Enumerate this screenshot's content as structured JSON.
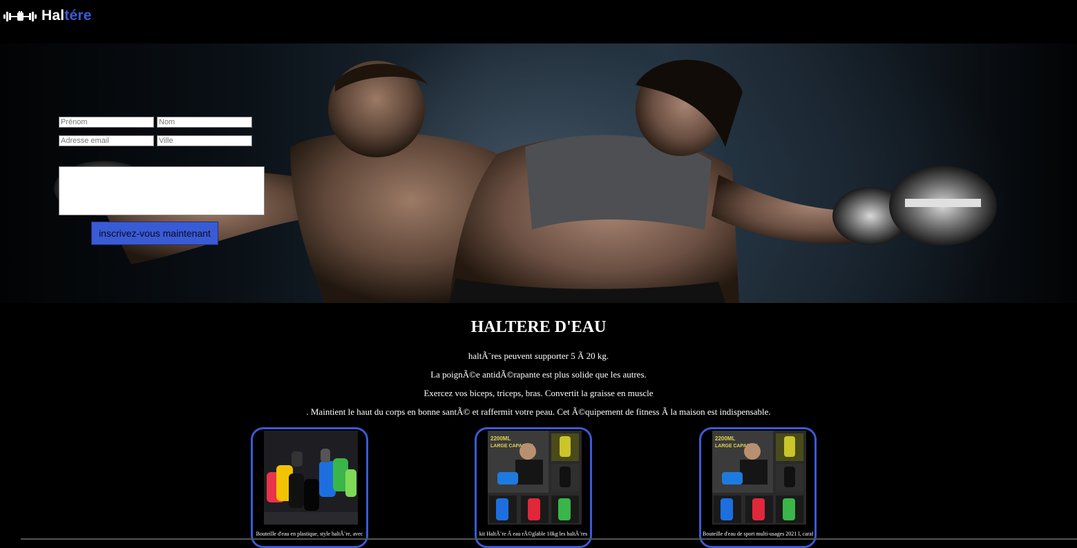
{
  "brand": {
    "name_part1": "Hal",
    "name_part2": "tére",
    "accent_color": "#3a5bd6",
    "icon": "dumbbell-fist-icon"
  },
  "form": {
    "first_name_placeholder": "Prénom",
    "last_name_placeholder": "Nom",
    "email_placeholder": "Adresse email",
    "city_placeholder": "Ville",
    "message_placeholder": "",
    "submit_label": "inscrivez-vous maintenant"
  },
  "content": {
    "title": "HALTERE D'EAU",
    "lines": [
      "haltÃ¨res peuvent supporter 5 Ã  20 kg.",
      "La poignÃ©e antidÃ©rapante est plus solide que les autres.",
      "Exercez vos biceps, triceps, bras. Convertit la graisse en muscle",
      ". Maintient le haut du corps en bonne santÃ© et raffermit votre peau. Cet Ã©quipement de fitness Ã  la maison est indispensable."
    ]
  },
  "products": [
    {
      "caption": "Bouteille d'eau en plastique, style haltÃ¨re, avec",
      "image": "colorful-dumbbell-bottles"
    },
    {
      "caption": "kit HaltÃ¨re Ã  eau rÃ©glable 10kg les haltÃ¨res",
      "image": "man-with-water-dumbbells-grid"
    },
    {
      "caption": "Bouteille d'eau de sport multi-usages 2021 l, carafe",
      "image": "man-with-water-dumbbells-grid"
    }
  ]
}
